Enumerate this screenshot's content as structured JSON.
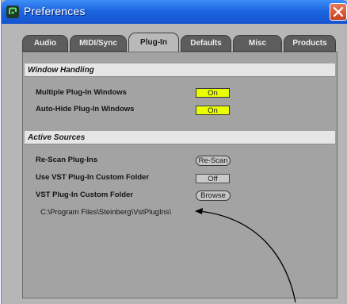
{
  "window": {
    "title": "Preferences"
  },
  "tabs": [
    {
      "label": "Audio",
      "active": false
    },
    {
      "label": "MIDI/Sync",
      "active": false
    },
    {
      "label": "Plug-In",
      "active": true
    },
    {
      "label": "Defaults",
      "active": false
    },
    {
      "label": "Misc",
      "active": false
    },
    {
      "label": "Products",
      "active": false
    }
  ],
  "window_handling": {
    "header": "Window Handling",
    "multiple_windows": {
      "label": "Multiple Plug-In Windows",
      "value": "On"
    },
    "auto_hide": {
      "label": "Auto-Hide Plug-In Windows",
      "value": "On"
    }
  },
  "active_sources": {
    "header": "Active Sources",
    "rescan": {
      "label": "Re-Scan Plug-Ins",
      "button": "Re-Scan"
    },
    "use_custom": {
      "label": "Use VST Plug-In Custom Folder",
      "value": "Off"
    },
    "custom_folder": {
      "label": "VST Plug-In Custom Folder",
      "button": "Browse"
    },
    "path": "C:\\Program Files\\Steinberg\\VstPlugIns\\"
  },
  "colors": {
    "toggle_on": "#e9ff00",
    "titlebar": "#1c66e0",
    "panel": "#a3a3a3"
  },
  "icons": {
    "app": "live-app-icon",
    "close": "close-icon"
  }
}
